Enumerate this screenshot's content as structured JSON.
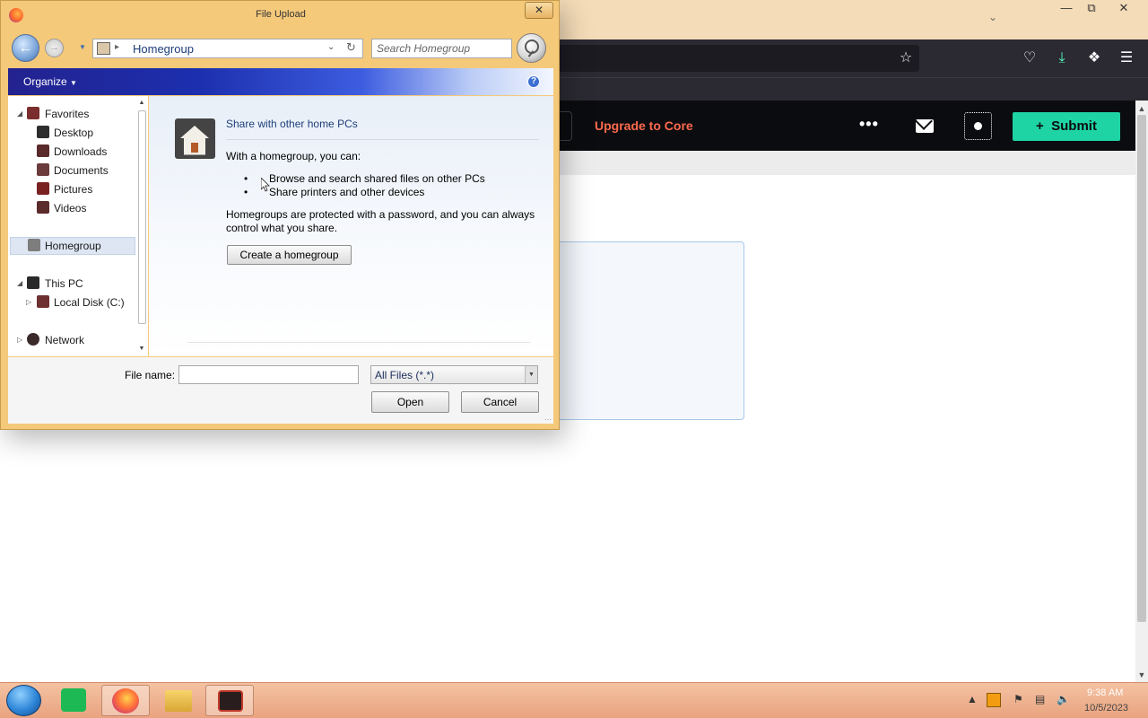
{
  "browser": {
    "upgrade_link": "Upgrade to Core",
    "more_icon": "more-dots-icon",
    "submit_label": "Submit"
  },
  "dialog": {
    "title": "File Upload",
    "address": "Homegroup",
    "search_placeholder": "Search Homegroup",
    "organize_label": "Organize",
    "nav": {
      "favorites": "Favorites",
      "desktop": "Desktop",
      "downloads": "Downloads",
      "documents": "Documents",
      "pictures": "Pictures",
      "videos": "Videos",
      "homegroup": "Homegroup",
      "this_pc": "This PC",
      "local_disk": "Local Disk (C:)",
      "network": "Network"
    },
    "homegroup": {
      "title": "Share with other home PCs",
      "intro": "With a homegroup, you can:",
      "bullets": [
        "Browse and search shared files on other PCs",
        "Share printers and other devices"
      ],
      "note": "Homegroups are protected with a password, and you can always control what you share.",
      "create_button": "Create a homegroup"
    },
    "file_name_label": "File name:",
    "file_name_value": "",
    "file_type": "All Files (*.*)",
    "open_button": "Open",
    "cancel_button": "Cancel"
  },
  "taskbar": {
    "time": "9:38 AM",
    "date": "10/5/2023"
  },
  "colors": {
    "dialog_frame": "#f5c97a",
    "command_bar": "#23228f",
    "submit_green": "#1ed4a4",
    "upgrade_orange": "#ff6a4d",
    "taskbar": "#f4c2a2"
  }
}
